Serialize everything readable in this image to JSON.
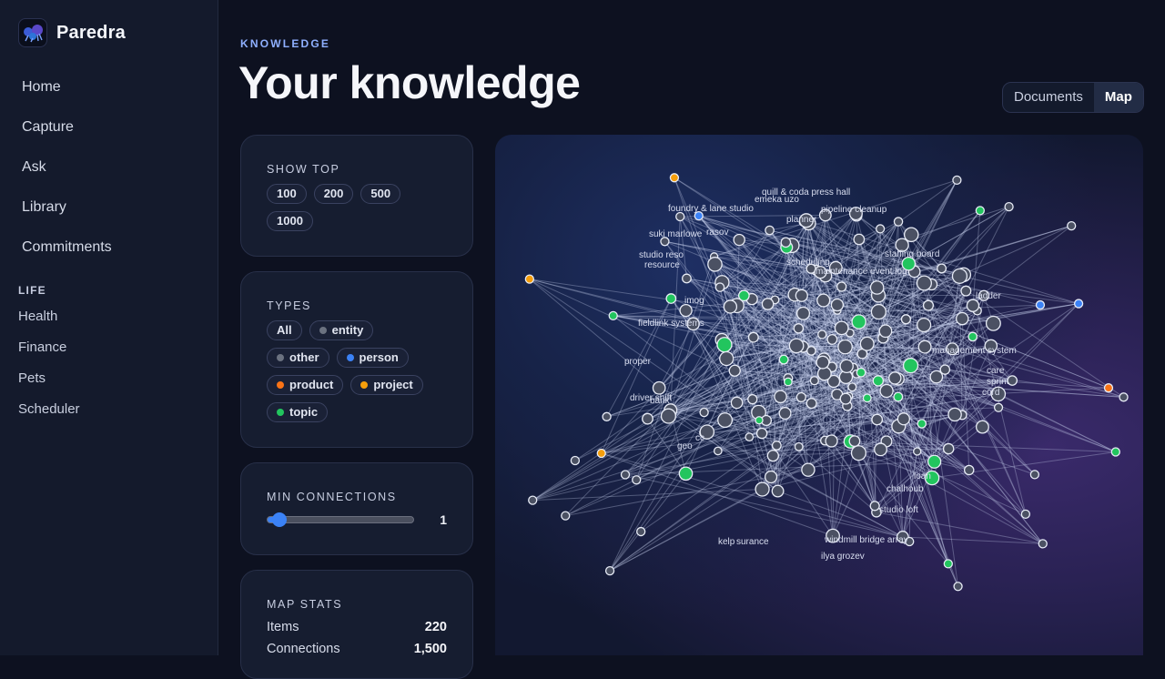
{
  "app": {
    "name": "Paredra"
  },
  "sidebar": {
    "items": [
      {
        "label": "Home",
        "name": "home"
      },
      {
        "label": "Capture",
        "name": "capture"
      },
      {
        "label": "Ask",
        "name": "ask"
      },
      {
        "label": "Library",
        "name": "library"
      },
      {
        "label": "Commitments",
        "name": "commitments"
      }
    ],
    "section_label": "LIFE",
    "sub_items": [
      {
        "label": "Health",
        "name": "health"
      },
      {
        "label": "Finance",
        "name": "finance"
      },
      {
        "label": "Pets",
        "name": "pets"
      },
      {
        "label": "Scheduler",
        "name": "scheduler"
      }
    ]
  },
  "header": {
    "eyebrow": "KNOWLEDGE",
    "title": "Your knowledge",
    "view_toggle": {
      "documents": "Documents",
      "map": "Map",
      "active": "Map"
    }
  },
  "show_top": {
    "label": "SHOW TOP",
    "options": [
      "100",
      "200",
      "500",
      "1000"
    ]
  },
  "types": {
    "label": "TYPES",
    "options": [
      {
        "label": "All",
        "color": null
      },
      {
        "label": "entity",
        "color": "#6b7280"
      },
      {
        "label": "other",
        "color": "#6b7280"
      },
      {
        "label": "person",
        "color": "#3b82f6"
      },
      {
        "label": "product",
        "color": "#f97316"
      },
      {
        "label": "project",
        "color": "#f59e0b"
      },
      {
        "label": "topic",
        "color": "#22c55e"
      }
    ]
  },
  "min_connections": {
    "label": "MIN CONNECTIONS",
    "value": "1",
    "fraction": 0.08
  },
  "map_stats": {
    "label": "MAP STATS",
    "rows": [
      {
        "label": "Items",
        "value": "220"
      },
      {
        "label": "Connections",
        "value": "1,500"
      }
    ]
  },
  "colors": {
    "accent": "#3b82f6",
    "entity": "#6b7280",
    "person": "#3b82f6",
    "product": "#f97316",
    "project": "#f59e0b",
    "topic": "#22c55e"
  },
  "map_labels": [
    "quill & coda press hall",
    "emeka uzo",
    "foundry & lane studio",
    "pipeline cleanup",
    "suki marlowe",
    "studio reso",
    "resource",
    "staffing board",
    "scheduling",
    "maintenance event log",
    "imog",
    "fieldlink systems",
    "proper",
    "driver shift",
    "bank",
    "management system",
    "sprint",
    "cc",
    "geo",
    "care",
    "cord",
    "windmill bridge array",
    "ilya grozev",
    "kelp",
    "surance",
    "studio loft",
    "chalhoub",
    "loan",
    "rasov",
    "ladder",
    "planner"
  ]
}
